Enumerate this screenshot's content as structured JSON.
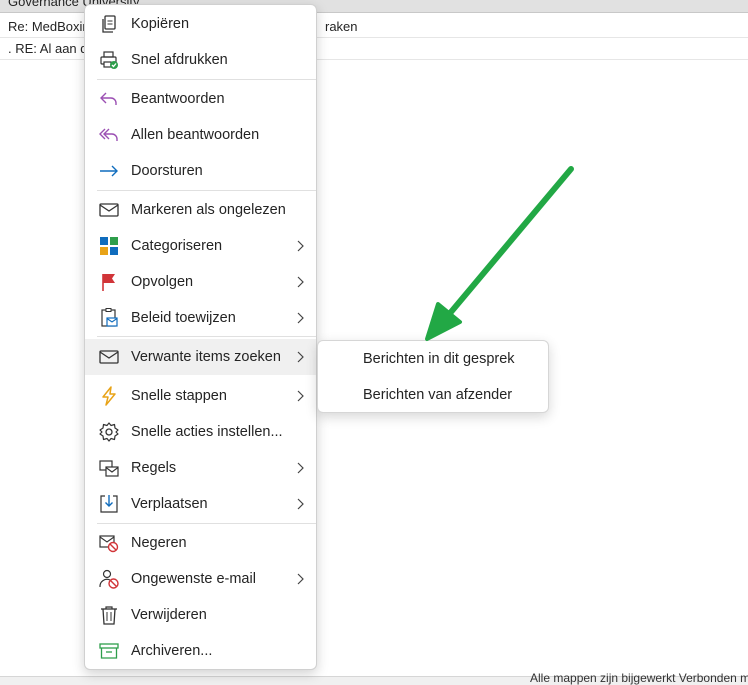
{
  "mail_list": {
    "row0": "Governance University",
    "row1_left": "Re: MedBoxin",
    "row1_right": "raken",
    "row2": ". RE: Al aan de",
    "footer": "Alle mappen zijn bijgewerkt  Verbonden met"
  },
  "context_menu": {
    "items": [
      {
        "label": "Kopiëren",
        "icon": "copy-icon"
      },
      {
        "label": "Snel afdrukken",
        "icon": "quick-print-icon"
      },
      {
        "label": "Beantwoorden",
        "icon": "reply-icon"
      },
      {
        "label": "Allen beantwoorden",
        "icon": "reply-all-icon"
      },
      {
        "label": "Doorsturen",
        "icon": "forward-icon"
      },
      {
        "label": "Markeren als ongelezen",
        "icon": "envelope-icon"
      },
      {
        "label": "Categoriseren",
        "icon": "categorize-icon"
      },
      {
        "label": "Opvolgen",
        "icon": "flag-icon"
      },
      {
        "label": "Beleid toewijzen",
        "icon": "policy-icon"
      },
      {
        "label": "Verwante items zoeken",
        "icon": "envelope-icon"
      },
      {
        "label": "Snelle stappen",
        "icon": "lightning-icon"
      },
      {
        "label": "Snelle acties instellen...",
        "icon": "gear-icon"
      },
      {
        "label": "Regels",
        "icon": "rules-icon"
      },
      {
        "label": "Verplaatsen",
        "icon": "move-icon"
      },
      {
        "label": "Negeren",
        "icon": "ignore-icon"
      },
      {
        "label": "Ongewenste e-mail",
        "icon": "junk-icon"
      },
      {
        "label": "Verwijderen",
        "icon": "trash-icon"
      },
      {
        "label": "Archiveren...",
        "icon": "archive-icon"
      }
    ]
  },
  "submenu": {
    "items": [
      {
        "label": "Berichten in dit gesprek"
      },
      {
        "label": "Berichten van afzender"
      }
    ]
  },
  "colors": {
    "accent_blue": "#0f6cbd",
    "reply_purple": "#9b4fb3",
    "flag_red": "#d13438",
    "arrow_green": "#22a845",
    "highlight": "#f0f0f0"
  }
}
